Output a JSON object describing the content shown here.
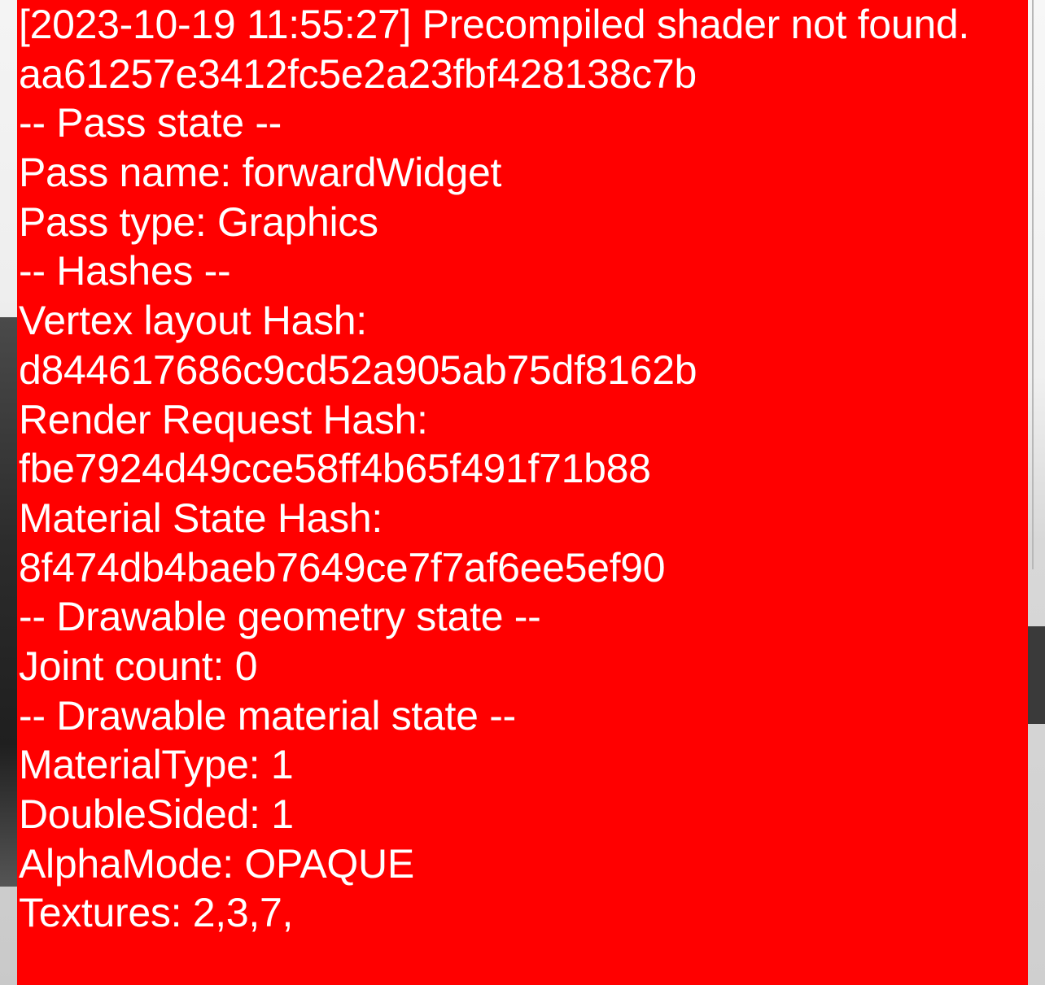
{
  "overlay": {
    "background_color": "#ff0000",
    "text_color": "#ffffff",
    "lines": [
      "[2023-10-19 11:55:27] Precompiled shader not found.",
      "aa61257e3412fc5e2a23fbf428138c7b",
      "-- Pass state --",
      "Pass name: forwardWidget",
      "Pass type: Graphics",
      "-- Hashes --",
      "Vertex layout Hash:",
      "d844617686c9cd52a905ab75df8162b",
      "Render Request Hash:",
      "fbe7924d49cce58ff4b65f491f71b88",
      "Material State Hash:",
      "8f474db4baeb7649ce7f7af6ee5ef90",
      "-- Drawable geometry state --",
      "Joint count: 0",
      "-- Drawable material state --",
      "MaterialType: 1",
      "DoubleSided: 1",
      "AlphaMode: OPAQUE",
      "Textures: 2,3,7,"
    ]
  }
}
